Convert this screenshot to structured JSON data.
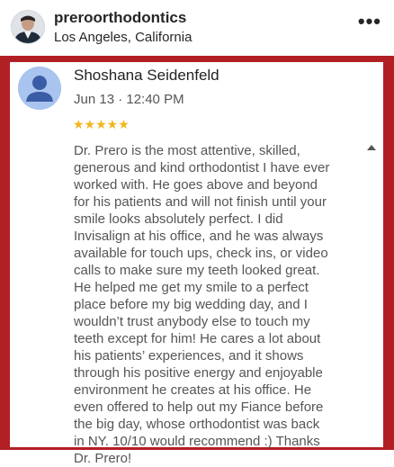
{
  "post_header": {
    "username": "preroorthodontics",
    "location": "Los Angeles, California",
    "avatar_icon": "profile-photo",
    "more_icon": "more-horizontal-icon"
  },
  "review": {
    "reviewer_name": "Shoshana Seidenfeld",
    "date": "Jun 13 · 12:40 PM",
    "rating_stars": "★★★★★",
    "rating_value": 5,
    "star_color": "#f2b51a",
    "frame_color": "#b11f24",
    "text": "Dr. Prero is the most attentive, skilled,\ngenerous and kind orthodontist I have ever\nworked with. He goes above and beyond\nfor his patients and will not finish until your\nsmile looks absolutely perfect. I did\nInvisalign at his office, and he was always\navailable for touch ups, check ins, or video\ncalls to make sure my teeth looked great.\nHe helped me get my smile to a perfect\nplace before my big wedding day, and I\nwouldn’t trust anybody else to touch my\nteeth except for him! He cares a lot about\nhis patients’ experiences, and it shows\nthrough his positive energy and enjoyable\nenvironment he creates at his office. He\neven offered to help out my Fiance before\nthe big day, whose orthodontist was back\nin NY. 10/10 would recommend :) Thanks\nDr. Prero!"
  }
}
